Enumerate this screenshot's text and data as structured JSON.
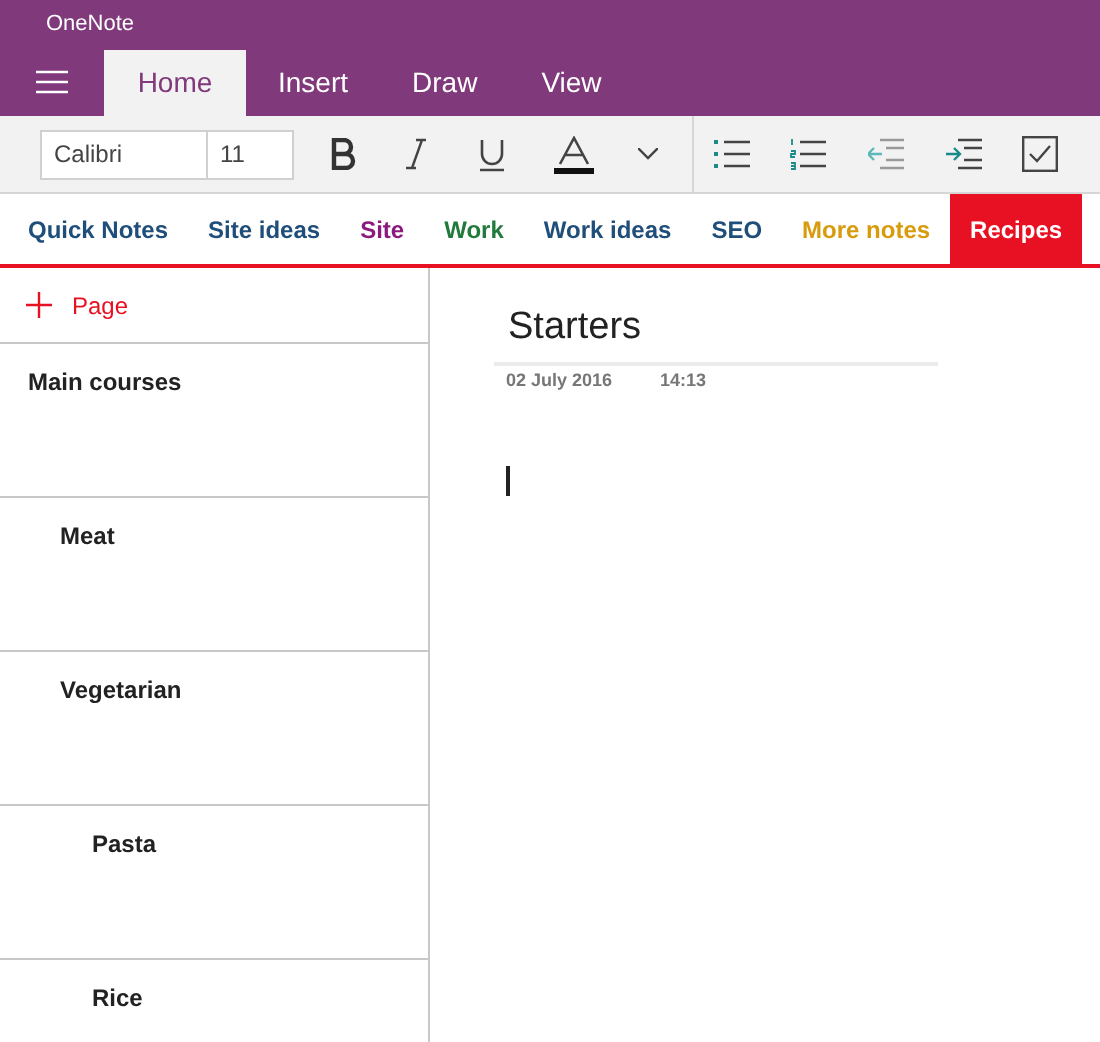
{
  "window": {
    "title": "OneNote"
  },
  "ribbon_tabs": [
    {
      "label": "Home",
      "selected": true
    },
    {
      "label": "Insert",
      "selected": false
    },
    {
      "label": "Draw",
      "selected": false
    },
    {
      "label": "View",
      "selected": false
    }
  ],
  "toolbar": {
    "font": "Calibri",
    "size": "11"
  },
  "sections": [
    {
      "label": "Quick Notes",
      "color": "#1e4e79",
      "selected": false
    },
    {
      "label": "Site ideas",
      "color": "#1e4e79",
      "selected": false
    },
    {
      "label": "Site",
      "color": "#8b1a7e",
      "selected": false
    },
    {
      "label": "Work",
      "color": "#217a3c",
      "selected": false
    },
    {
      "label": "Work ideas",
      "color": "#1e4e79",
      "selected": false
    },
    {
      "label": "SEO",
      "color": "#1e4e79",
      "selected": false
    },
    {
      "label": "More notes",
      "color": "#d89b0c",
      "selected": false
    },
    {
      "label": "Recipes",
      "color": "#e81123",
      "selected": true
    }
  ],
  "add_page": "Page",
  "pages": [
    {
      "title": "Main courses",
      "children": [
        {
          "title": "Meat"
        },
        {
          "title": "Vegetarian",
          "children": [
            {
              "title": "Pasta"
            },
            {
              "title": "Rice"
            }
          ]
        }
      ]
    }
  ],
  "note": {
    "title": "Starters",
    "date": "02 July 2016",
    "time": "14:13"
  }
}
